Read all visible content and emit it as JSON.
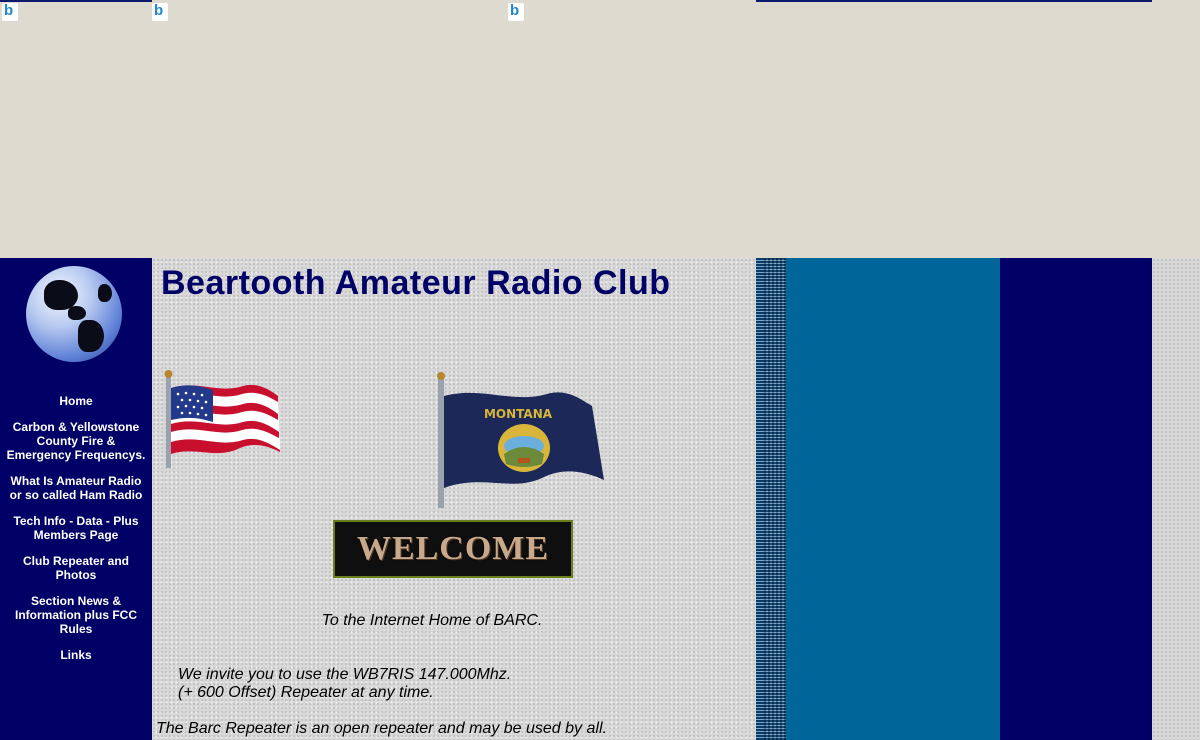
{
  "site": {
    "title": "Beartooth Amateur Radio Club",
    "tagline": "To the Internet Home of BARC.",
    "invite_line1": "We invite you to use the WB7RIS 147.000Mhz.",
    "invite_line2": "(+ 600 Offset) Repeater at any time.",
    "open_repeater": "The Barc Repeater is an open repeater and may be used by all.",
    "welcome_banner": "WELCOME",
    "state_flag_text": "MONTANA"
  },
  "nav": {
    "items": [
      {
        "label": "Home"
      },
      {
        "label": "Carbon & Yellowstone County Fire & Emergency Frequencys."
      },
      {
        "label": "What Is Amateur Radio or so called Ham Radio"
      },
      {
        "label": "Tech Info - Data - Plus Members Page"
      },
      {
        "label": "Club Repeater and Photos"
      },
      {
        "label": "Section News & Information plus FCC Rules"
      },
      {
        "label": "Links"
      }
    ]
  },
  "icons": {
    "broken_image": "bing-icon",
    "globe": "globe-icon",
    "us_flag": "us-flag-icon",
    "montana_flag": "montana-flag-icon"
  },
  "colors": {
    "sidebar": "#000066",
    "title": "#000066",
    "teal_column": "#006699"
  }
}
